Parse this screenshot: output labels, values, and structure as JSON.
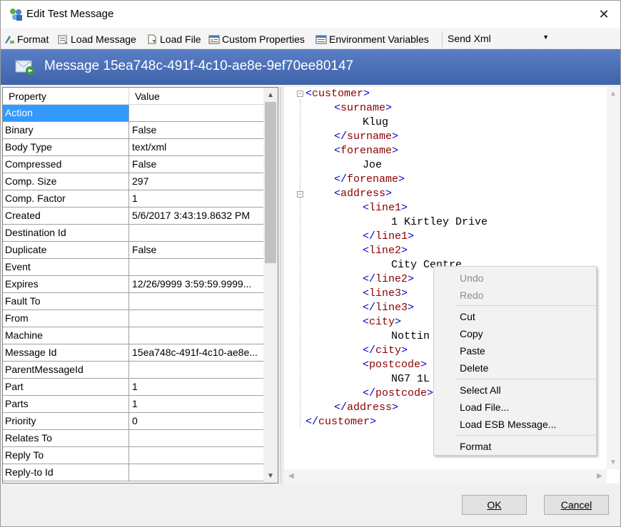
{
  "window": {
    "title": "Edit Test Message"
  },
  "toolbar": {
    "format": "Format",
    "load_message": "Load Message",
    "load_file": "Load File",
    "custom_properties": "Custom Properties",
    "environment_variables": "Environment Variables",
    "send_mode": "Send Xml"
  },
  "header": {
    "title": "Message 15ea748c-491f-4c10-ae8e-9ef70ee80147"
  },
  "grid": {
    "col_property": "Property",
    "col_value": "Value",
    "rows": [
      {
        "property": "Action",
        "value": ""
      },
      {
        "property": "Binary",
        "value": "False"
      },
      {
        "property": "Body Type",
        "value": "text/xml"
      },
      {
        "property": "Compressed",
        "value": "False"
      },
      {
        "property": "Comp. Size",
        "value": "297"
      },
      {
        "property": "Comp. Factor",
        "value": "1"
      },
      {
        "property": "Created",
        "value": "5/6/2017 3:43:19.8632 PM"
      },
      {
        "property": "Destination Id",
        "value": ""
      },
      {
        "property": "Duplicate",
        "value": "False"
      },
      {
        "property": "Event",
        "value": ""
      },
      {
        "property": "Expires",
        "value": "12/26/9999 3:59:59.9999..."
      },
      {
        "property": "Fault To",
        "value": ""
      },
      {
        "property": "From",
        "value": ""
      },
      {
        "property": "Machine",
        "value": ""
      },
      {
        "property": "Message Id",
        "value": "15ea748c-491f-4c10-ae8e..."
      },
      {
        "property": "ParentMessageId",
        "value": ""
      },
      {
        "property": "Part",
        "value": "1"
      },
      {
        "property": "Parts",
        "value": "1"
      },
      {
        "property": "Priority",
        "value": "0"
      },
      {
        "property": "Relates To",
        "value": ""
      },
      {
        "property": "Reply To",
        "value": ""
      },
      {
        "property": "Reply-to Id",
        "value": ""
      }
    ]
  },
  "xml": {
    "customer_open": "customer",
    "surname_open": "surname",
    "surname_text": "Klug",
    "surname_close": "surname",
    "forename_open": "forename",
    "forename_text": "Joe",
    "forename_close": "forename",
    "address_open": "address",
    "line1_open": "line1",
    "line1_text": "1 Kirtley Drive",
    "line1_close": "line1",
    "line2_open": "line2",
    "line2_text": "City Centre",
    "line2_close": "line2",
    "line3_open": "line3",
    "line3_close": "line3",
    "city_open": "city",
    "city_text": "Nottin",
    "city_close": "city",
    "postcode_open": "postcode",
    "postcode_text": "NG7 1L",
    "postcode_close": "postcode",
    "address_close": "address",
    "customer_close": "customer"
  },
  "context_menu": {
    "undo": "Undo",
    "redo": "Redo",
    "cut": "Cut",
    "copy": "Copy",
    "paste": "Paste",
    "delete": "Delete",
    "select_all": "Select All",
    "load_file": "Load File...",
    "load_esb": "Load ESB Message...",
    "format": "Format"
  },
  "buttons": {
    "ok": "OK",
    "cancel": "Cancel"
  }
}
